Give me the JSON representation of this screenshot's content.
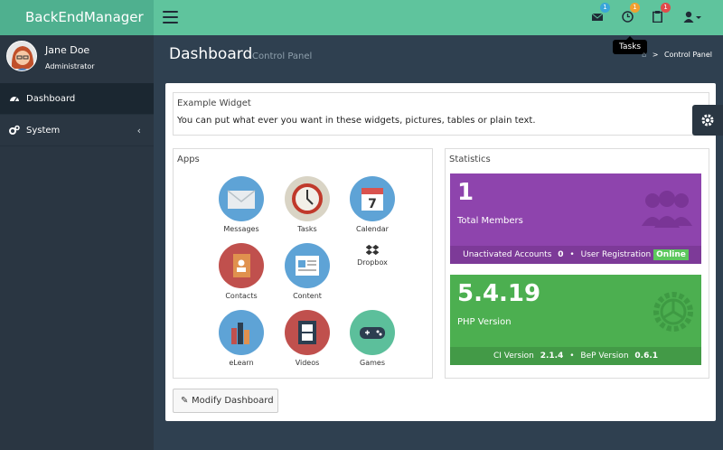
{
  "app": {
    "brand": "BackEndManager"
  },
  "topbar": {
    "badges": {
      "messages": "1",
      "tasks": "1",
      "notifications": "1"
    },
    "tooltip": "Tasks"
  },
  "user": {
    "name": "Jane Doe",
    "role": "Administrator"
  },
  "sidebar": {
    "items": [
      {
        "label": "Dashboard"
      },
      {
        "label": "System"
      }
    ]
  },
  "header": {
    "title": "Dashboard",
    "subtitle": "Control Panel",
    "breadcrumb": "Control Panel"
  },
  "widget": {
    "title": "Example Widget",
    "text": "You can put what ever you want in these widgets, pictures, tables or plain text."
  },
  "apps": {
    "title": "Apps",
    "items": [
      "Messages",
      "Tasks",
      "Calendar",
      "Dropbox",
      "Contacts",
      "Content",
      "eLearn",
      "Videos",
      "Games"
    ],
    "calendar_day": "7"
  },
  "stats": {
    "title": "Statistics",
    "members": {
      "value": "1",
      "label": "Total Members",
      "unactivated_label": "Unactivated Accounts",
      "unactivated_value": "0",
      "registration_label": "User Registration",
      "registration_status": "Online"
    },
    "php": {
      "value": "5.4.19",
      "label": "PHP Version",
      "ci_label": "CI Version",
      "ci_value": "2.1.4",
      "bep_label": "BeP Version",
      "bep_value": "0.6.1"
    }
  },
  "buttons": {
    "modify": "Modify Dashboard"
  },
  "colors": {
    "brand": "#4fb08f",
    "topbar": "#5fc49d",
    "sidebar": "#2a3642",
    "purple": "#8e44ad",
    "green": "#4caf50"
  }
}
